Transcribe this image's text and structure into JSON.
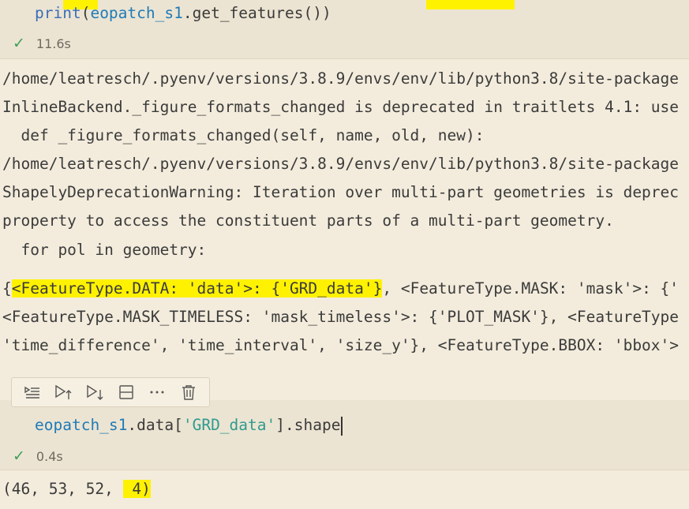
{
  "cell1": {
    "code_tokens": [
      "print",
      "(",
      "eopatch_s1",
      ".get_features())"
    ],
    "status_time": "11.6s"
  },
  "output1": {
    "lines": [
      "/home/leatresch/.pyenv/versions/3.8.9/envs/env/lib/python3.8/site-package",
      "InlineBackend._figure_formats_changed is deprecated in traitlets 4.1: use",
      "  def _figure_formats_changed(self, name, old, new):",
      "/home/leatresch/.pyenv/versions/3.8.9/envs/env/lib/python3.8/site-package",
      "ShapelyDeprecationWarning: Iteration over multi-part geometries is deprec",
      "property to access the constituent parts of a multi-part geometry.",
      "  for pol in geometry:"
    ],
    "result_first_prefix": "{",
    "result_first_highlight": "<FeatureType.DATA: 'data'>: {'GRD_data'}",
    "result_first_rest": ", <FeatureType.MASK: 'mask'>: {'",
    "result_lines": [
      "<FeatureType.MASK_TIMELESS: 'mask_timeless'>: {'PLOT_MASK'}, <FeatureType",
      "'time_difference', 'time_interval', 'size_y'}, <FeatureType.BBOX: 'bbox'>"
    ]
  },
  "toolbar": {
    "icons": [
      "run-by-line-icon",
      "execute-above-icon",
      "execute-below-icon",
      "split-cell-icon",
      "more-icon",
      "delete-icon"
    ]
  },
  "cell2": {
    "code_var": "eopatch_s1",
    "code_mid1": ".data[",
    "code_str": "'GRD_data'",
    "code_mid2": "].shape",
    "status_time": "0.4s"
  },
  "output2": {
    "prefix": "(46, 53, 52, ",
    "highlight": " 4)"
  }
}
